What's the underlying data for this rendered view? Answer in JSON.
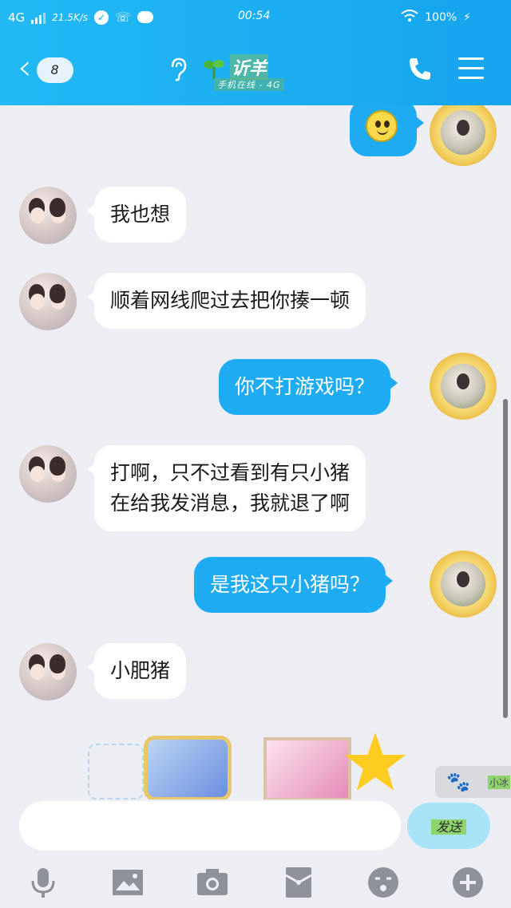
{
  "status_bar": {
    "network": "4G",
    "speed": "21.5K/s",
    "time": "00:54",
    "battery": "100%"
  },
  "header": {
    "unread_count": "8",
    "contact_name": "䜣羊",
    "contact_status": "手机在线 - 4G"
  },
  "messages": [
    {
      "side": "right",
      "type": "emoji",
      "icon": "smiley-emoji-icon"
    },
    {
      "side": "left",
      "type": "text",
      "text": "我也想"
    },
    {
      "side": "left",
      "type": "text",
      "text": "顺着网线爬过去把你揍一顿"
    },
    {
      "side": "right",
      "type": "text",
      "text": "你不打游戏吗？"
    },
    {
      "side": "left",
      "type": "text",
      "lines": [
        "打啊，只不过看到有只小猪",
        "在给我发消息，我就退了啊"
      ]
    },
    {
      "side": "right",
      "type": "text",
      "text": "是我这只小猪吗？"
    },
    {
      "side": "left",
      "type": "text",
      "text": "小肥猪"
    }
  ],
  "sticker_panel": {
    "side_label": "小冰"
  },
  "composer": {
    "input_value": "",
    "send_label": "发送"
  },
  "toolbar": {
    "items": [
      "microphone-icon",
      "image-icon",
      "camera-icon",
      "red-packet-icon",
      "sticker-face-icon",
      "plus-icon"
    ]
  },
  "colors": {
    "header": "#1aa9f0",
    "outgoing_bubble": "#1eabf2",
    "incoming_bubble": "#ffffff",
    "background": "#eceef4"
  }
}
